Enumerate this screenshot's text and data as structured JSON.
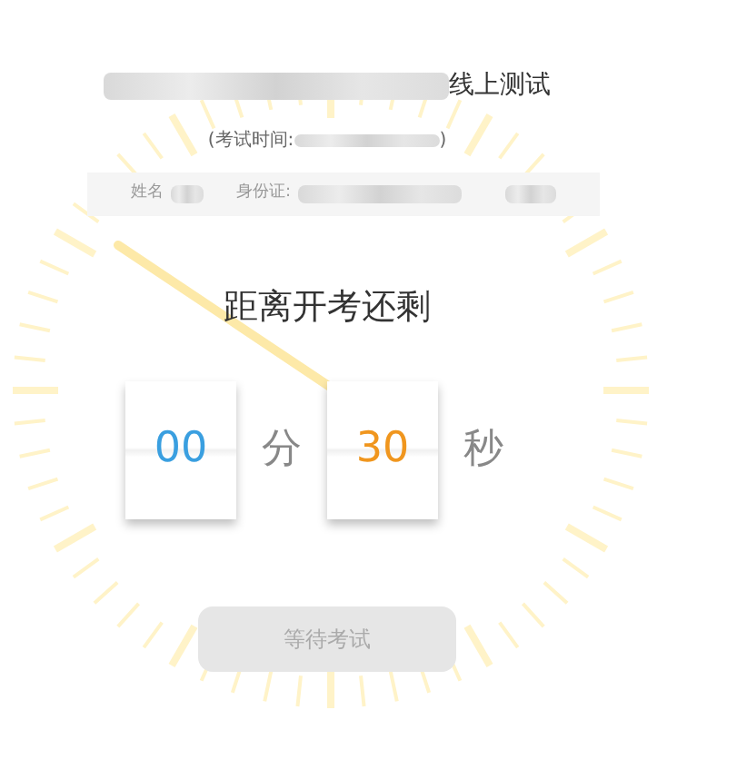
{
  "title": {
    "suffix": "线上测试"
  },
  "exam_time": {
    "open": "(考试时间:",
    "close": ")"
  },
  "info_bar": {
    "name_label": "姓名",
    "id_label": "身份证:"
  },
  "countdown_heading": "距离开考还剩",
  "countdown": [
    {
      "value": "00",
      "unit": "分",
      "color": "#3a9fe0"
    },
    {
      "value": "30",
      "unit": "秒",
      "color": "#f0961e"
    }
  ],
  "button": {
    "label": "等待考试",
    "disabled": true
  }
}
